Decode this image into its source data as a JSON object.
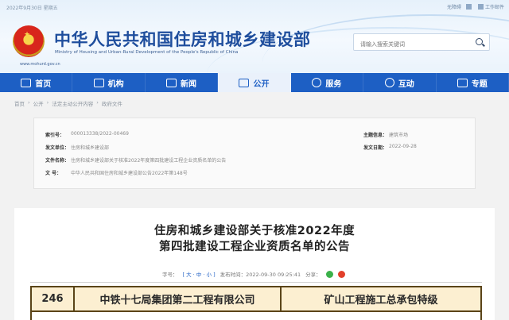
{
  "header": {
    "date_line": "2022年9月30日 星期五",
    "top_links": [
      "无障碍",
      "",
      "工作邮件"
    ],
    "title": "中华人民共和国住房和城乡建设部",
    "subtitle": "Ministry of Housing and Urban-Rural Development of the People's Republic of China",
    "url": "www.mohurd.gov.cn",
    "search_placeholder": "请输入搜索关键词"
  },
  "nav": [
    {
      "label": "首页",
      "icon": "home-icon"
    },
    {
      "label": "机构",
      "icon": "building-icon"
    },
    {
      "label": "新闻",
      "icon": "news-icon"
    },
    {
      "label": "公开",
      "icon": "document-icon",
      "active": true
    },
    {
      "label": "服务",
      "icon": "service-icon"
    },
    {
      "label": "互动",
      "icon": "chat-icon"
    },
    {
      "label": "专题",
      "icon": "folder-icon"
    }
  ],
  "breadcrumb": [
    "首页",
    "公开",
    "法定主动公开内容",
    "政府文件"
  ],
  "meta": {
    "index_label": "索引号：",
    "index_value": "000013338/2022-00469",
    "issuer_label": "发文单位：",
    "issuer_value": "住房和城乡建设部",
    "title_label": "文件名称：",
    "title_value": "住房和城乡建设部关于核准2022年度第四批建设工程企业资质名单的公告",
    "number_label": "文  号：",
    "number_value": "中华人民共和国住房和城乡建设部公告2022年第148号",
    "category_label": "主题信息：",
    "category_value": "建筑市场",
    "date_label": "发文日期：",
    "date_value": "2022-09-28"
  },
  "article": {
    "title_line1": "住房和城乡建设部关于核准2022年度",
    "title_line2": "第四批建设工程企业资质名单的公告",
    "font_size_label": "字号：",
    "font_sizes": "[ 大 · 中 · 小 ]",
    "publish_label": "发布时间：2022-09-30 09:25:41",
    "share_label": "分享："
  },
  "table_row": {
    "number": "246",
    "company": "中铁十七局集团第二工程有限公司",
    "qualification": "矿山工程施工总承包特级"
  }
}
